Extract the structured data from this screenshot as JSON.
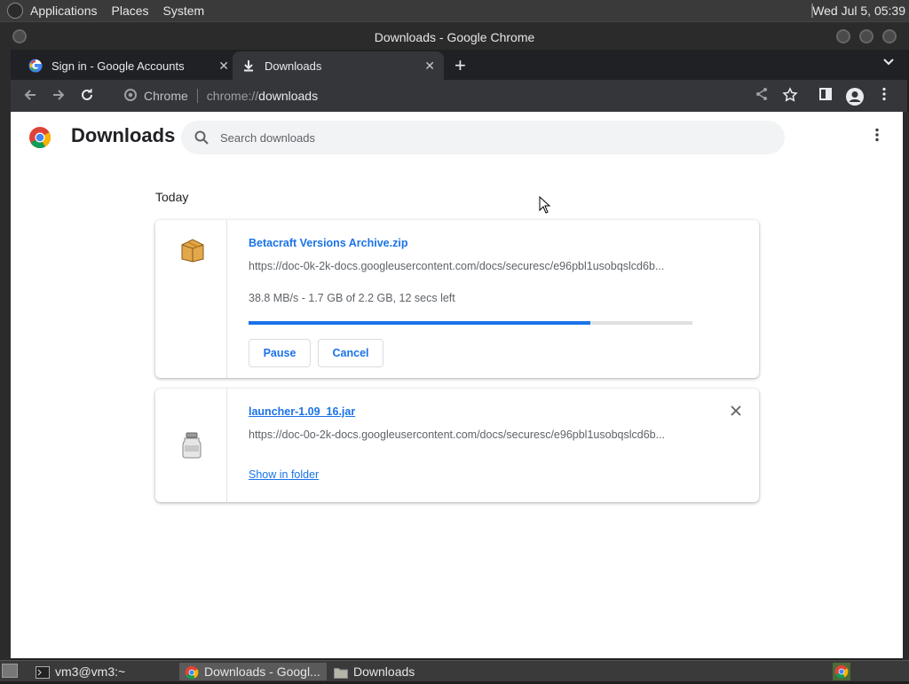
{
  "top_panel": {
    "menus": [
      "Applications",
      "Places",
      "System"
    ],
    "clock": "Wed Jul  5, 05:39"
  },
  "window": {
    "title": "Downloads - Google Chrome"
  },
  "tabs": [
    {
      "label": "Sign in - Google Accounts",
      "icon": "google-g-icon",
      "active": false
    },
    {
      "label": "Downloads",
      "icon": "download-icon",
      "active": true
    }
  ],
  "omnibox": {
    "chip_label": "Chrome",
    "url_scheme": "chrome://",
    "url_host": "downloads"
  },
  "page": {
    "title": "Downloads",
    "search_placeholder": "Search downloads",
    "date_header": "Today",
    "downloads": [
      {
        "file_name": "Betacraft Versions Archive.zip",
        "url": "https://doc-0k-2k-docs.googleusercontent.com/docs/securesc/e96pbl1usobqslcd6b...",
        "status": "38.8 MB/s - 1.7 GB of 2.2 GB, 12 secs left",
        "progress": 0.77,
        "buttons": [
          "Pause",
          "Cancel"
        ],
        "icon": "archive-box-icon"
      },
      {
        "file_name": "launcher-1.09_16.jar",
        "url": "https://doc-0o-2k-docs.googleusercontent.com/docs/securesc/e96pbl1usobqslcd6b...",
        "action_link": "Show in folder",
        "icon": "jar-icon"
      }
    ]
  },
  "taskbar": {
    "items": [
      {
        "label": "vm3@vm3:~",
        "icon": "terminal-icon",
        "active": false
      },
      {
        "label": "Downloads - Googl...",
        "icon": "chrome-icon",
        "active": true
      },
      {
        "label": "Downloads",
        "icon": "folder-icon",
        "active": false
      }
    ]
  },
  "colors": {
    "accent": "#1a73e8",
    "chrome_frame": "#202124",
    "toolbar": "#35363a"
  }
}
